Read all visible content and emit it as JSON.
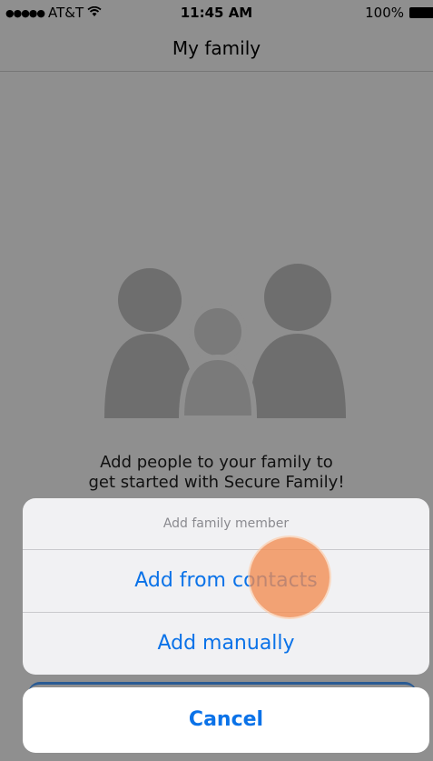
{
  "status_bar": {
    "carrier": "AT&T",
    "time": "11:45 AM",
    "battery": "100%"
  },
  "nav": {
    "title": "My family"
  },
  "empty_state": {
    "line1": "Add people to your family to",
    "line2": "get started with Secure Family!"
  },
  "action_sheet": {
    "title": "Add family member",
    "options": [
      "Add from contacts",
      "Add manually"
    ],
    "cancel": "Cancel"
  },
  "colors": {
    "accent": "#0a72e8",
    "overlay": "#8f8f8f",
    "touch_indicator": "#f28c50"
  },
  "icons": [
    "signal-icon",
    "wifi-icon",
    "battery-icon",
    "family-silhouette-icon"
  ]
}
